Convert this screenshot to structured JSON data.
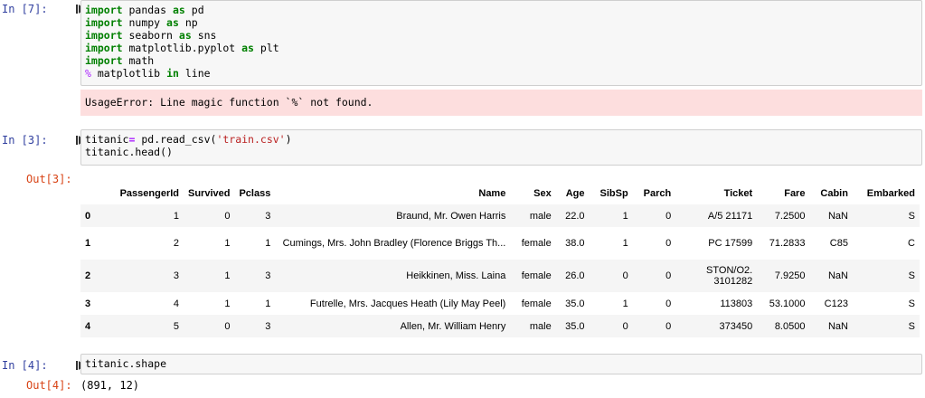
{
  "cells": [
    {
      "prompt": "In [7]:"
    },
    {
      "prompt": "In [3]:",
      "out_prompt": "Out[3]:"
    },
    {
      "prompt": "In [4]:",
      "out_prompt": "Out[4]:",
      "output": "(891, 12)"
    }
  ],
  "error": {
    "text": "UsageError: Line magic function `%` not found."
  },
  "dataframe": {
    "columns": [
      "PassengerId",
      "Survived",
      "Pclass",
      "Name",
      "Sex",
      "Age",
      "SibSp",
      "Parch",
      "Ticket",
      "Fare",
      "Cabin",
      "Embarked"
    ],
    "rows": [
      {
        "index": "0",
        "cells": [
          "1",
          "0",
          "3",
          "Braund, Mr. Owen Harris",
          "male",
          "22.0",
          "1",
          "0",
          "A/5 21171",
          "7.2500",
          "NaN",
          "S"
        ]
      },
      {
        "index": "1",
        "cells": [
          "2",
          "1",
          "1",
          "Cumings, Mrs. John Bradley (Florence Briggs Th...",
          "female",
          "38.0",
          "1",
          "0",
          "PC 17599",
          "71.2833",
          "C85",
          "C"
        ]
      },
      {
        "index": "2",
        "cells": [
          "3",
          "1",
          "3",
          "Heikkinen, Miss. Laina",
          "female",
          "26.0",
          "0",
          "0",
          "STON/O2. 3101282",
          "7.9250",
          "NaN",
          "S"
        ]
      },
      {
        "index": "3",
        "cells": [
          "4",
          "1",
          "1",
          "Futrelle, Mrs. Jacques Heath (Lily May Peel)",
          "female",
          "35.0",
          "1",
          "0",
          "113803",
          "53.1000",
          "C123",
          "S"
        ]
      },
      {
        "index": "4",
        "cells": [
          "5",
          "0",
          "3",
          "Allen, Mr. William Henry",
          "male",
          "35.0",
          "0",
          "0",
          "373450",
          "8.0500",
          "NaN",
          "S"
        ]
      }
    ]
  },
  "code": {
    "c7": [
      "import",
      "pandas",
      "as",
      "pd",
      "import",
      "numpy",
      "as",
      "np",
      "import",
      "seaborn",
      "as",
      "sns",
      "import",
      "matplotlib.pyplot",
      "as",
      "plt",
      "import",
      "math",
      "%",
      "matplotlib",
      "in",
      "line"
    ],
    "c3": [
      "titanic",
      "=",
      "pd.read_csv(",
      "'train.csv'",
      ")",
      "titanic.head()"
    ],
    "c4": [
      "titanic.shape"
    ]
  },
  "icons": {
    "run": "run-cell-icon"
  },
  "colors": {
    "in_prompt": "#303f9f",
    "out_prompt": "#d84315",
    "error_bg": "#fddede",
    "keyword": "#008000",
    "string": "#ba2121"
  }
}
